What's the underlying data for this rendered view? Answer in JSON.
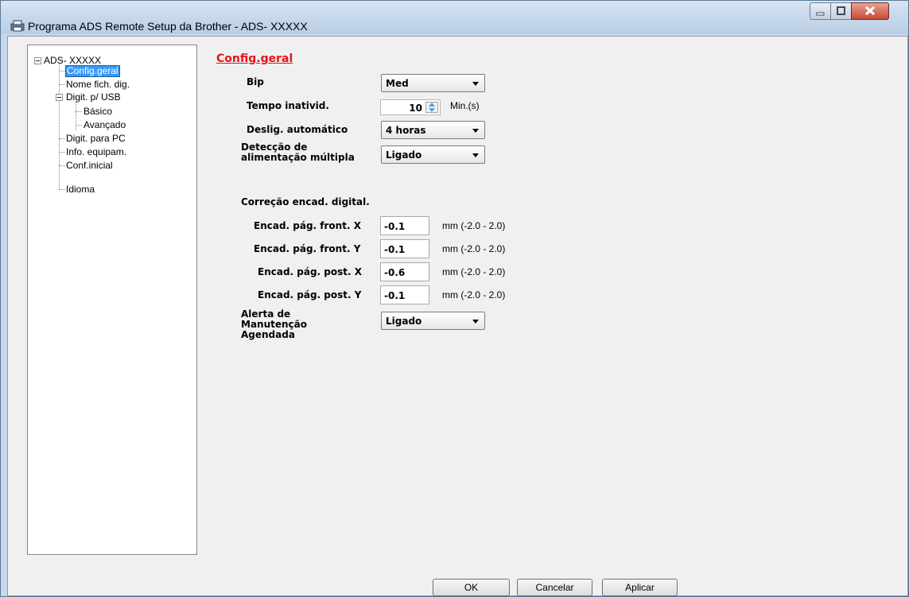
{
  "window": {
    "title": "Programa ADS Remote Setup da Brother - ADS- XXXXX"
  },
  "tree": {
    "root": "ADS- XXXXX",
    "items": [
      {
        "label": "Config.geral"
      },
      {
        "label": "Nome fich. dig."
      },
      {
        "label": "Digit. p/ USB"
      },
      {
        "label": "Básico"
      },
      {
        "label": "Avançado"
      },
      {
        "label": "Digit. para PC"
      },
      {
        "label": "Info. equipam."
      },
      {
        "label": "Conf.inicial"
      },
      {
        "label": "Idioma"
      }
    ]
  },
  "panel": {
    "heading": "Config.geral",
    "bip": {
      "label": "Bip",
      "value": "Med"
    },
    "tempo": {
      "label": "Tempo inativid.",
      "value": "10",
      "unit": "Min.(s)"
    },
    "deslig": {
      "label": "Deslig. automático",
      "value": "4 horas"
    },
    "deteccao": {
      "label1": "Detecção de",
      "label2": "alimentação múltipla",
      "value": "Ligado"
    },
    "correcao_title": "Correção encad. digital.",
    "encad": [
      {
        "label": "Encad. pág. front. X",
        "value": "-0.1",
        "range": "mm (-2.0 - 2.0)"
      },
      {
        "label": "Encad. pág. front. Y",
        "value": "-0.1",
        "range": "mm (-2.0 - 2.0)"
      },
      {
        "label": "Encad. pág. post. X",
        "value": "-0.6",
        "range": "mm (-2.0 - 2.0)"
      },
      {
        "label": "Encad. pág. post. Y",
        "value": "-0.1",
        "range": "mm (-2.0 - 2.0)"
      }
    ],
    "alerta": {
      "label1": "Alerta de",
      "label2": "Manutenção",
      "label3": "Agendada",
      "value": "Ligado"
    }
  },
  "buttons": {
    "ok": "OK",
    "cancel": "Cancelar",
    "apply": "Aplicar"
  }
}
